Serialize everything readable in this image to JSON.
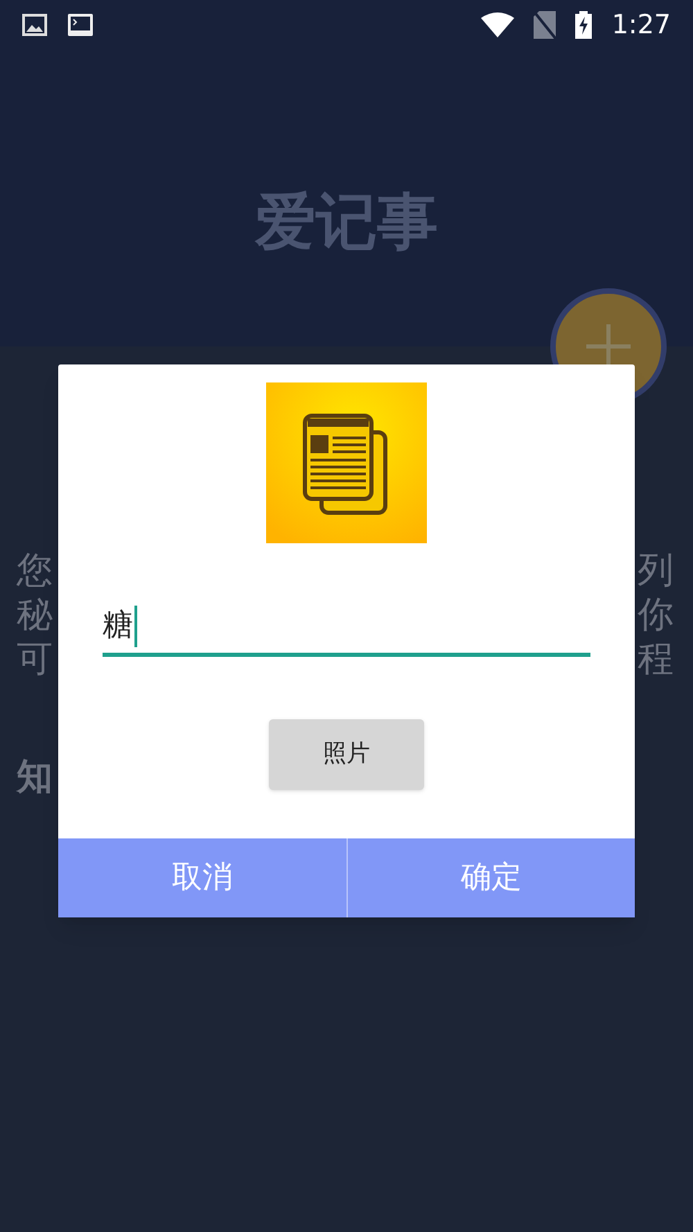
{
  "status_bar": {
    "time": "1:27"
  },
  "app": {
    "title": "爱记事",
    "left_chars": [
      "您",
      "秘",
      "可"
    ],
    "right_chars": [
      "列",
      "你",
      "程"
    ],
    "heading_char": "知"
  },
  "dialog": {
    "input": {
      "value": "糖"
    },
    "photo_button": "照片",
    "buttons": [
      "取消",
      "确定"
    ]
  }
}
